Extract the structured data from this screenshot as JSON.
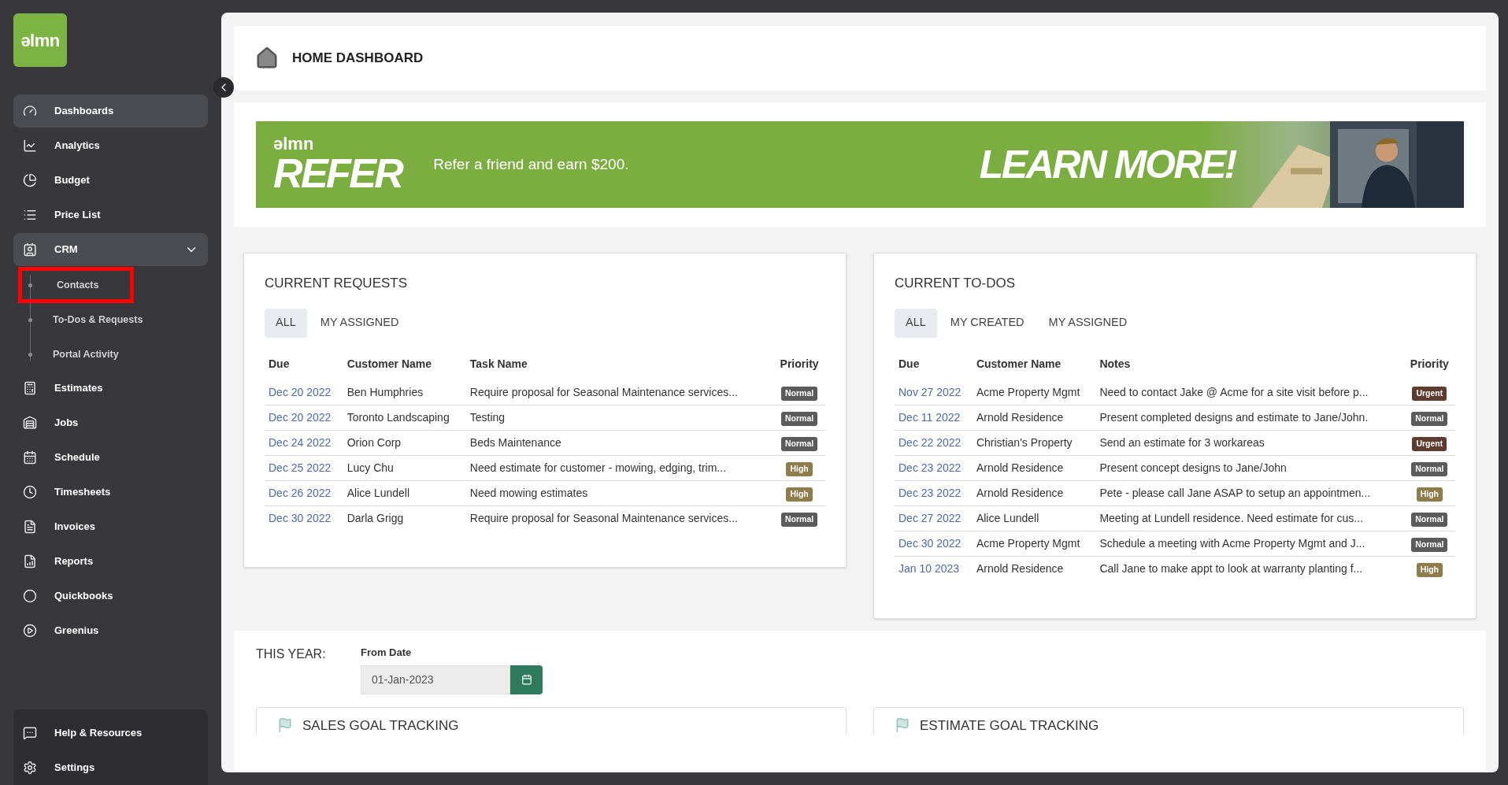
{
  "logo": {
    "text": "ǝlmn"
  },
  "sidebar": {
    "items": [
      {
        "kind": "item",
        "label": "Dashboards",
        "selected": true
      },
      {
        "kind": "item",
        "label": "Analytics",
        "selected": false
      },
      {
        "kind": "item",
        "label": "Budget",
        "selected": false
      },
      {
        "kind": "item",
        "label": "Price List",
        "selected": false
      },
      {
        "kind": "group",
        "label": "CRM",
        "expanded": true,
        "children": [
          {
            "label": "Contacts",
            "highlighted": true
          },
          {
            "label": "To-Dos & Requests",
            "highlighted": false
          },
          {
            "label": "Portal Activity",
            "highlighted": false
          }
        ]
      },
      {
        "kind": "item",
        "label": "Estimates",
        "selected": false
      },
      {
        "kind": "item",
        "label": "Jobs",
        "selected": false
      },
      {
        "kind": "item",
        "label": "Schedule",
        "selected": false
      },
      {
        "kind": "item",
        "label": "Timesheets",
        "selected": false
      },
      {
        "kind": "item",
        "label": "Invoices",
        "selected": false
      },
      {
        "kind": "item",
        "label": "Reports",
        "selected": false
      },
      {
        "kind": "item",
        "label": "Quickbooks",
        "selected": false
      },
      {
        "kind": "item",
        "label": "Greenius",
        "selected": false
      }
    ],
    "footer": [
      {
        "label": "Help & Resources"
      },
      {
        "label": "Settings"
      }
    ]
  },
  "page_title": "HOME DASHBOARD",
  "banner": {
    "brand": "ǝlmn",
    "title": "REFER",
    "text": "Refer a friend and earn $200.",
    "cta": "LEARN MORE!"
  },
  "requests": {
    "title": "CURRENT REQUESTS",
    "tabs": [
      {
        "label": "ALL",
        "selected": true
      },
      {
        "label": "MY ASSIGNED",
        "selected": false
      }
    ],
    "columns": [
      "Due",
      "Customer Name",
      "Task Name",
      "Priority"
    ],
    "rows": [
      {
        "due": "Dec 20 2022",
        "customer": "Ben Humphries",
        "text": "Require proposal for Seasonal Maintenance services...",
        "priority": "Normal",
        "color": "#5b5b5b"
      },
      {
        "due": "Dec 20 2022",
        "customer": "Toronto Landscaping",
        "text": "Testing",
        "priority": "Normal",
        "color": "#5b5b5b"
      },
      {
        "due": "Dec 24 2022",
        "customer": "Orion Corp",
        "text": "Beds Maintenance",
        "priority": "Normal",
        "color": "#5b5b5b"
      },
      {
        "due": "Dec 25 2022",
        "customer": "Lucy Chu",
        "text": "Need estimate for customer - mowing, edging, trim...",
        "priority": "High",
        "color": "#8e7c4a"
      },
      {
        "due": "Dec 26 2022",
        "customer": "Alice Lundell",
        "text": "Need mowing estimates",
        "priority": "High",
        "color": "#8e7c4a"
      },
      {
        "due": "Dec 30 2022",
        "customer": "Darla Grigg",
        "text": "Require proposal for Seasonal Maintenance services...",
        "priority": "Normal",
        "color": "#5b5b5b"
      }
    ]
  },
  "todos": {
    "title": "CURRENT TO-DOS",
    "tabs": [
      {
        "label": "ALL",
        "selected": true
      },
      {
        "label": "MY CREATED",
        "selected": false
      },
      {
        "label": "MY ASSIGNED",
        "selected": false
      }
    ],
    "columns": [
      "Due",
      "Customer Name",
      "Notes",
      "Priority"
    ],
    "rows": [
      {
        "due": "Nov 27 2022",
        "customer": "Acme Property Mgmt",
        "text": "Need to contact Jake @ Acme for a site visit before p...",
        "priority": "Urgent",
        "color": "#5e3b2f"
      },
      {
        "due": "Dec 11 2022",
        "customer": "Arnold Residence",
        "text": "Present completed designs and estimate to Jane/John.",
        "priority": "Normal",
        "color": "#5b5b5b"
      },
      {
        "due": "Dec 22 2022",
        "customer": "Christian's Property",
        "text": "Send an estimate for 3 workareas",
        "priority": "Urgent",
        "color": "#5e3b2f"
      },
      {
        "due": "Dec 23 2022",
        "customer": "Arnold Residence",
        "text": "Present concept designs to Jane/John",
        "priority": "Normal",
        "color": "#5b5b5b"
      },
      {
        "due": "Dec 23 2022",
        "customer": "Arnold Residence",
        "text": "Pete - please call Jane ASAP to setup an appointmen...",
        "priority": "High",
        "color": "#8e7c4a"
      },
      {
        "due": "Dec 27 2022",
        "customer": "Alice Lundell",
        "text": "Meeting at Lundell residence. Need estimate for cus...",
        "priority": "Normal",
        "color": "#5b5b5b"
      },
      {
        "due": "Dec 30 2022",
        "customer": "Acme Property Mgmt",
        "text": "Schedule a meeting with Acme Property Mgmt and J...",
        "priority": "Normal",
        "color": "#5b5b5b"
      },
      {
        "due": "Jan 10 2023",
        "customer": "Arnold Residence",
        "text": "Call Jane to make appt to look at warranty planting f...",
        "priority": "High",
        "color": "#8e7c4a"
      }
    ]
  },
  "this_year": {
    "label": "THIS YEAR:",
    "field_label": "From Date",
    "value": "01-Jan-2023"
  },
  "goal_cards": [
    {
      "title": "SALES GOAL TRACKING"
    },
    {
      "title": "ESTIMATE GOAL TRACKING"
    }
  ]
}
